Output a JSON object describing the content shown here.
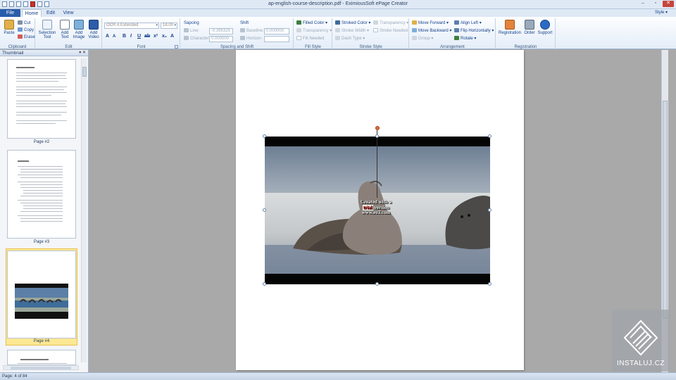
{
  "window": {
    "title": "ap-english-course-description.pdf - EximiousSoft ePage Creator"
  },
  "tabs": [
    {
      "label": "File"
    },
    {
      "label": "Home"
    },
    {
      "label": "Edit"
    },
    {
      "label": "View"
    }
  ],
  "style_menu": "Style ▾",
  "ribbon": {
    "clipboard": {
      "label": "Clipboard",
      "paste": "Paste",
      "cut": "Cut",
      "copy": "Copy",
      "erase": "Erase"
    },
    "edit": {
      "label": "Edit",
      "selection_tool": "Selection Tool",
      "add_text": "Add Text",
      "add_image": "Add Image",
      "add_video": "Add Video"
    },
    "font": {
      "label": "Font",
      "font_name": "OCR A Extended",
      "font_size": "18.00"
    },
    "spacing": {
      "label": "Spacing and Shift",
      "sapcing_title": "Sapcing",
      "line_label": "Line:",
      "line_value": "-0.395325",
      "character_label": "Character:",
      "character_value": "0.000000",
      "shift_title": "Shift",
      "baseline_label": "Baseline:",
      "baseline_value": "0.000000",
      "horizon_label": "Horizon:"
    },
    "fill": {
      "label": "Fill Style",
      "filled_color": "Filled Color",
      "transparency": "Transparency",
      "fill_needed": "Fill Needed"
    },
    "stroke": {
      "label": "Stroke Style",
      "stroked_color": "Stroked Color",
      "transparency": "Transparency",
      "stroke_width": "Stroke Width",
      "stroke_needed": "Stroke Needed",
      "dash_type": "Dash Type"
    },
    "arrangement": {
      "label": "Arrangement",
      "move_forward": "Move Forward",
      "move_backward": "Move Backward",
      "group": "Group",
      "align_left": "Align Left",
      "flip_horizontally": "Flip Horizontally",
      "rotate": "Rotate"
    },
    "registration": {
      "label": "Registration",
      "registration": "Registration",
      "order": "Order",
      "support": "Support"
    }
  },
  "thumbnail_pane": {
    "title": "Thumbnail",
    "pages": [
      {
        "label": "Page #2"
      },
      {
        "label": "Page #3"
      },
      {
        "label": "Page #4"
      }
    ]
  },
  "watermark": {
    "line1": "Created with a",
    "line2_left": "trial",
    "line2_accent": "version",
    "line3": "www.eo3.com"
  },
  "status": {
    "page_info": "Page: 4 of 84"
  },
  "badge": {
    "text": "INSTALUJ.CZ"
  },
  "icons": [
    "paste-icon",
    "cut-icon",
    "copy-icon",
    "erase-icon",
    "selection-tool-icon",
    "add-text-icon",
    "add-image-icon",
    "add-video-icon",
    "registration-icon",
    "order-icon",
    "support-icon"
  ]
}
